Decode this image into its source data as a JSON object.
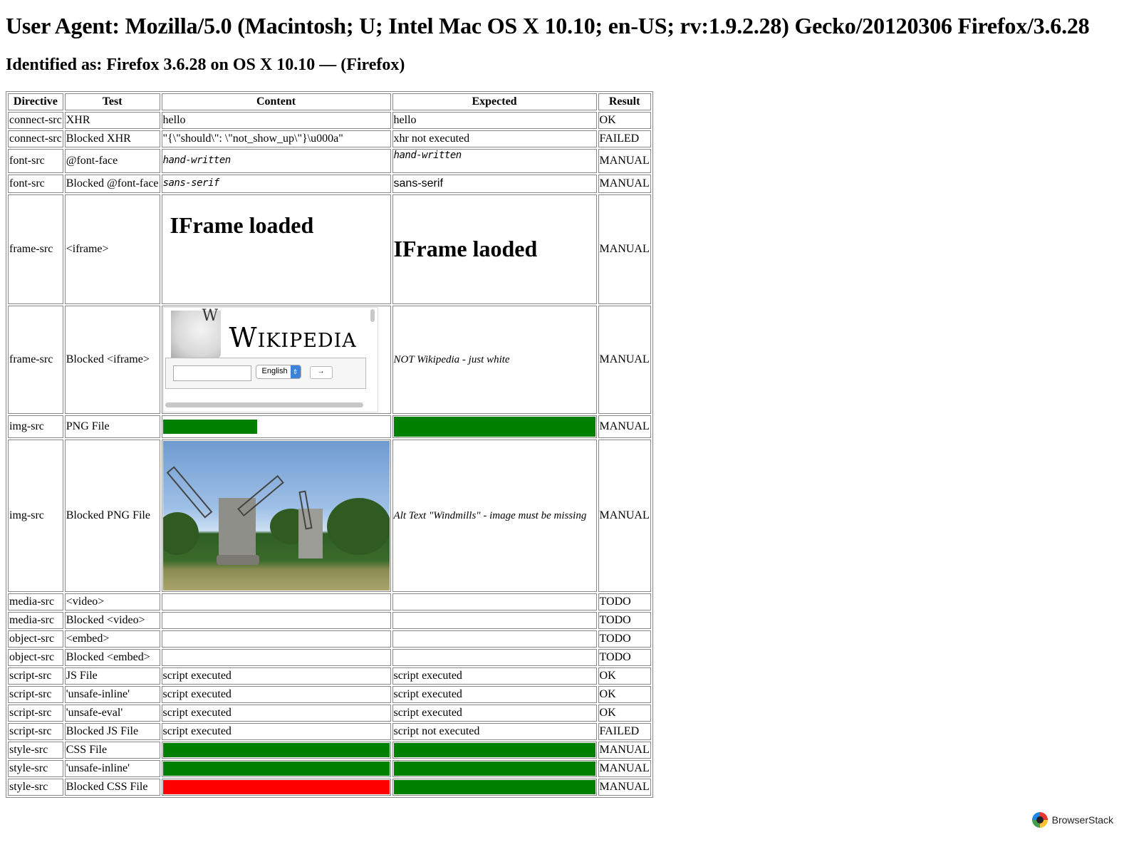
{
  "header": {
    "user_agent": "User Agent: Mozilla/5.0 (Macintosh; U; Intel Mac OS X 10.10; en-US; rv:1.9.2.28) Gecko/20120306 Firefox/3.6.28",
    "identified": "Identified as: Firefox 3.6.28 on OS X 10.10 — (Firefox)"
  },
  "table": {
    "columns": [
      "Directive",
      "Test",
      "Content",
      "Expected",
      "Result"
    ],
    "rows": [
      {
        "directive": "connect-src",
        "test": "XHR",
        "content": "hello",
        "expected": "hello",
        "result": "OK"
      },
      {
        "directive": "connect-src",
        "test": "Blocked XHR",
        "content": "\"{\\\"should\\\": \\\"not_show_up\\\"}\\u000a\"",
        "expected": "xhr not executed",
        "result": "FAILED"
      },
      {
        "directive": "font-src",
        "test": "@font-face",
        "content": "hand-written",
        "expected": "hand-written",
        "result": "MANUAL"
      },
      {
        "directive": "font-src",
        "test": "Blocked @font-face",
        "content": "sans-serif",
        "expected": "sans-serif",
        "result": "MANUAL"
      },
      {
        "directive": "frame-src",
        "test": "<iframe>",
        "content": "IFrame loaded",
        "expected": "IFrame laoded",
        "result": "MANUAL"
      },
      {
        "directive": "frame-src",
        "test": "Blocked <iframe>",
        "content_wiki_title": "Wikipedia",
        "content_wiki_lang": "English",
        "content_wiki_go": "→",
        "expected": "NOT Wikipedia - just white",
        "result": "MANUAL"
      },
      {
        "directive": "img-src",
        "test": "PNG File",
        "content": "",
        "expected": "",
        "result": "MANUAL"
      },
      {
        "directive": "img-src",
        "test": "Blocked PNG File",
        "content": "",
        "expected": "Alt Text \"Windmills\" - image must be missing",
        "result": "MANUAL"
      },
      {
        "directive": "media-src",
        "test": "<video>",
        "content": "",
        "expected": "",
        "result": "TODO"
      },
      {
        "directive": "media-src",
        "test": "Blocked <video>",
        "content": "",
        "expected": "",
        "result": "TODO"
      },
      {
        "directive": "object-src",
        "test": "<embed>",
        "content": "",
        "expected": "",
        "result": "TODO"
      },
      {
        "directive": "object-src",
        "test": "Blocked <embed>",
        "content": "",
        "expected": "",
        "result": "TODO"
      },
      {
        "directive": "script-src",
        "test": "JS File",
        "content": "script executed",
        "expected": "script executed",
        "result": "OK"
      },
      {
        "directive": "script-src",
        "test": "'unsafe-inline'",
        "content": "script executed",
        "expected": "script executed",
        "result": "OK"
      },
      {
        "directive": "script-src",
        "test": "'unsafe-eval'",
        "content": "script executed",
        "expected": "script executed",
        "result": "OK"
      },
      {
        "directive": "script-src",
        "test": "Blocked JS File",
        "content": "script executed",
        "expected": "script not executed",
        "result": "FAILED"
      },
      {
        "directive": "style-src",
        "test": "CSS File",
        "content": "",
        "expected": "",
        "result": "MANUAL"
      },
      {
        "directive": "style-src",
        "test": "'unsafe-inline'",
        "content": "",
        "expected": "",
        "result": "MANUAL"
      },
      {
        "directive": "style-src",
        "test": "Blocked CSS File",
        "content": "",
        "expected": "",
        "result": "MANUAL"
      }
    ]
  },
  "colors": {
    "green": "#008000",
    "red": "#ff0000"
  },
  "footer": {
    "brand": "BrowserStack",
    "icon": "browserstack-logo-icon"
  }
}
